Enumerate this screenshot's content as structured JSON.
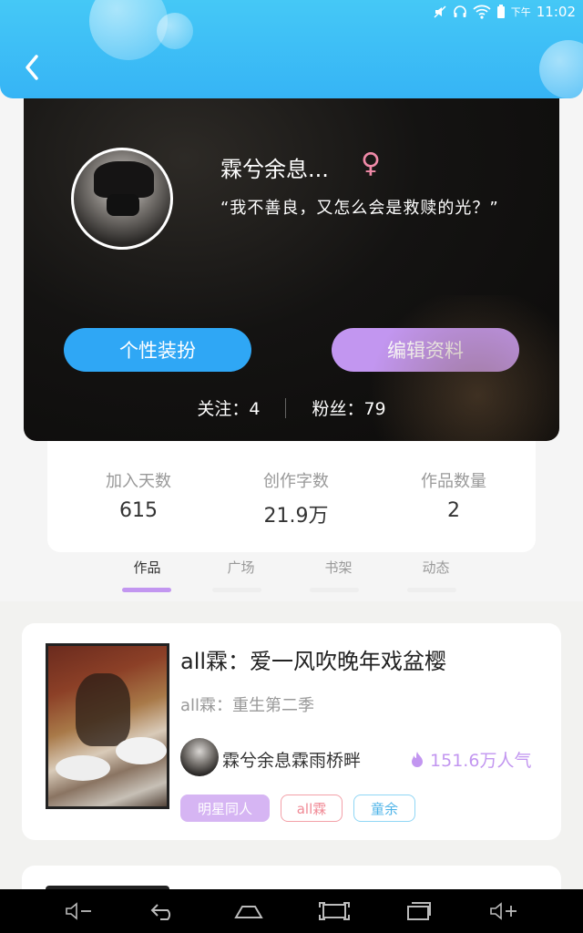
{
  "status_bar": {
    "time": "11:02",
    "period": "下午"
  },
  "profile": {
    "username": "霖兮余息...",
    "gender_symbol": "♀",
    "motto": "“我不善良，又怎么会是救赎的光？”",
    "buttons": {
      "decorate": "个性装扮",
      "edit": "编辑资料"
    },
    "follow": "关注：4",
    "fans": "粉丝：79"
  },
  "stats": [
    {
      "label": "加入天数",
      "value": "615"
    },
    {
      "label": "创作字数",
      "value": "21.9万"
    },
    {
      "label": "作品数量",
      "value": "2"
    }
  ],
  "tabs": [
    "作品",
    "广场",
    "书架",
    "动态"
  ],
  "active_tab": "作品",
  "work": {
    "title": "all霖：爱一风吹晚年戏盆樱",
    "subtitle": "all霖：重生第二季",
    "author": "霖兮余息霖雨桥畔",
    "popularity": "151.6万人气",
    "tags": [
      "明星同人",
      "all霖",
      "童余"
    ]
  },
  "colors": {
    "header": "#36b4f5",
    "accent_blue": "#2fa7f5",
    "accent_purple": "#c296f0",
    "gender_pink": "#f08aa8"
  },
  "icons": [
    "back-icon",
    "mute-icon",
    "headset-icon",
    "wifi-icon",
    "battery-icon",
    "flame-icon",
    "volume-down-icon",
    "nav-back-icon",
    "home-icon",
    "screenshot-icon",
    "recent-apps-icon",
    "volume-up-icon"
  ]
}
